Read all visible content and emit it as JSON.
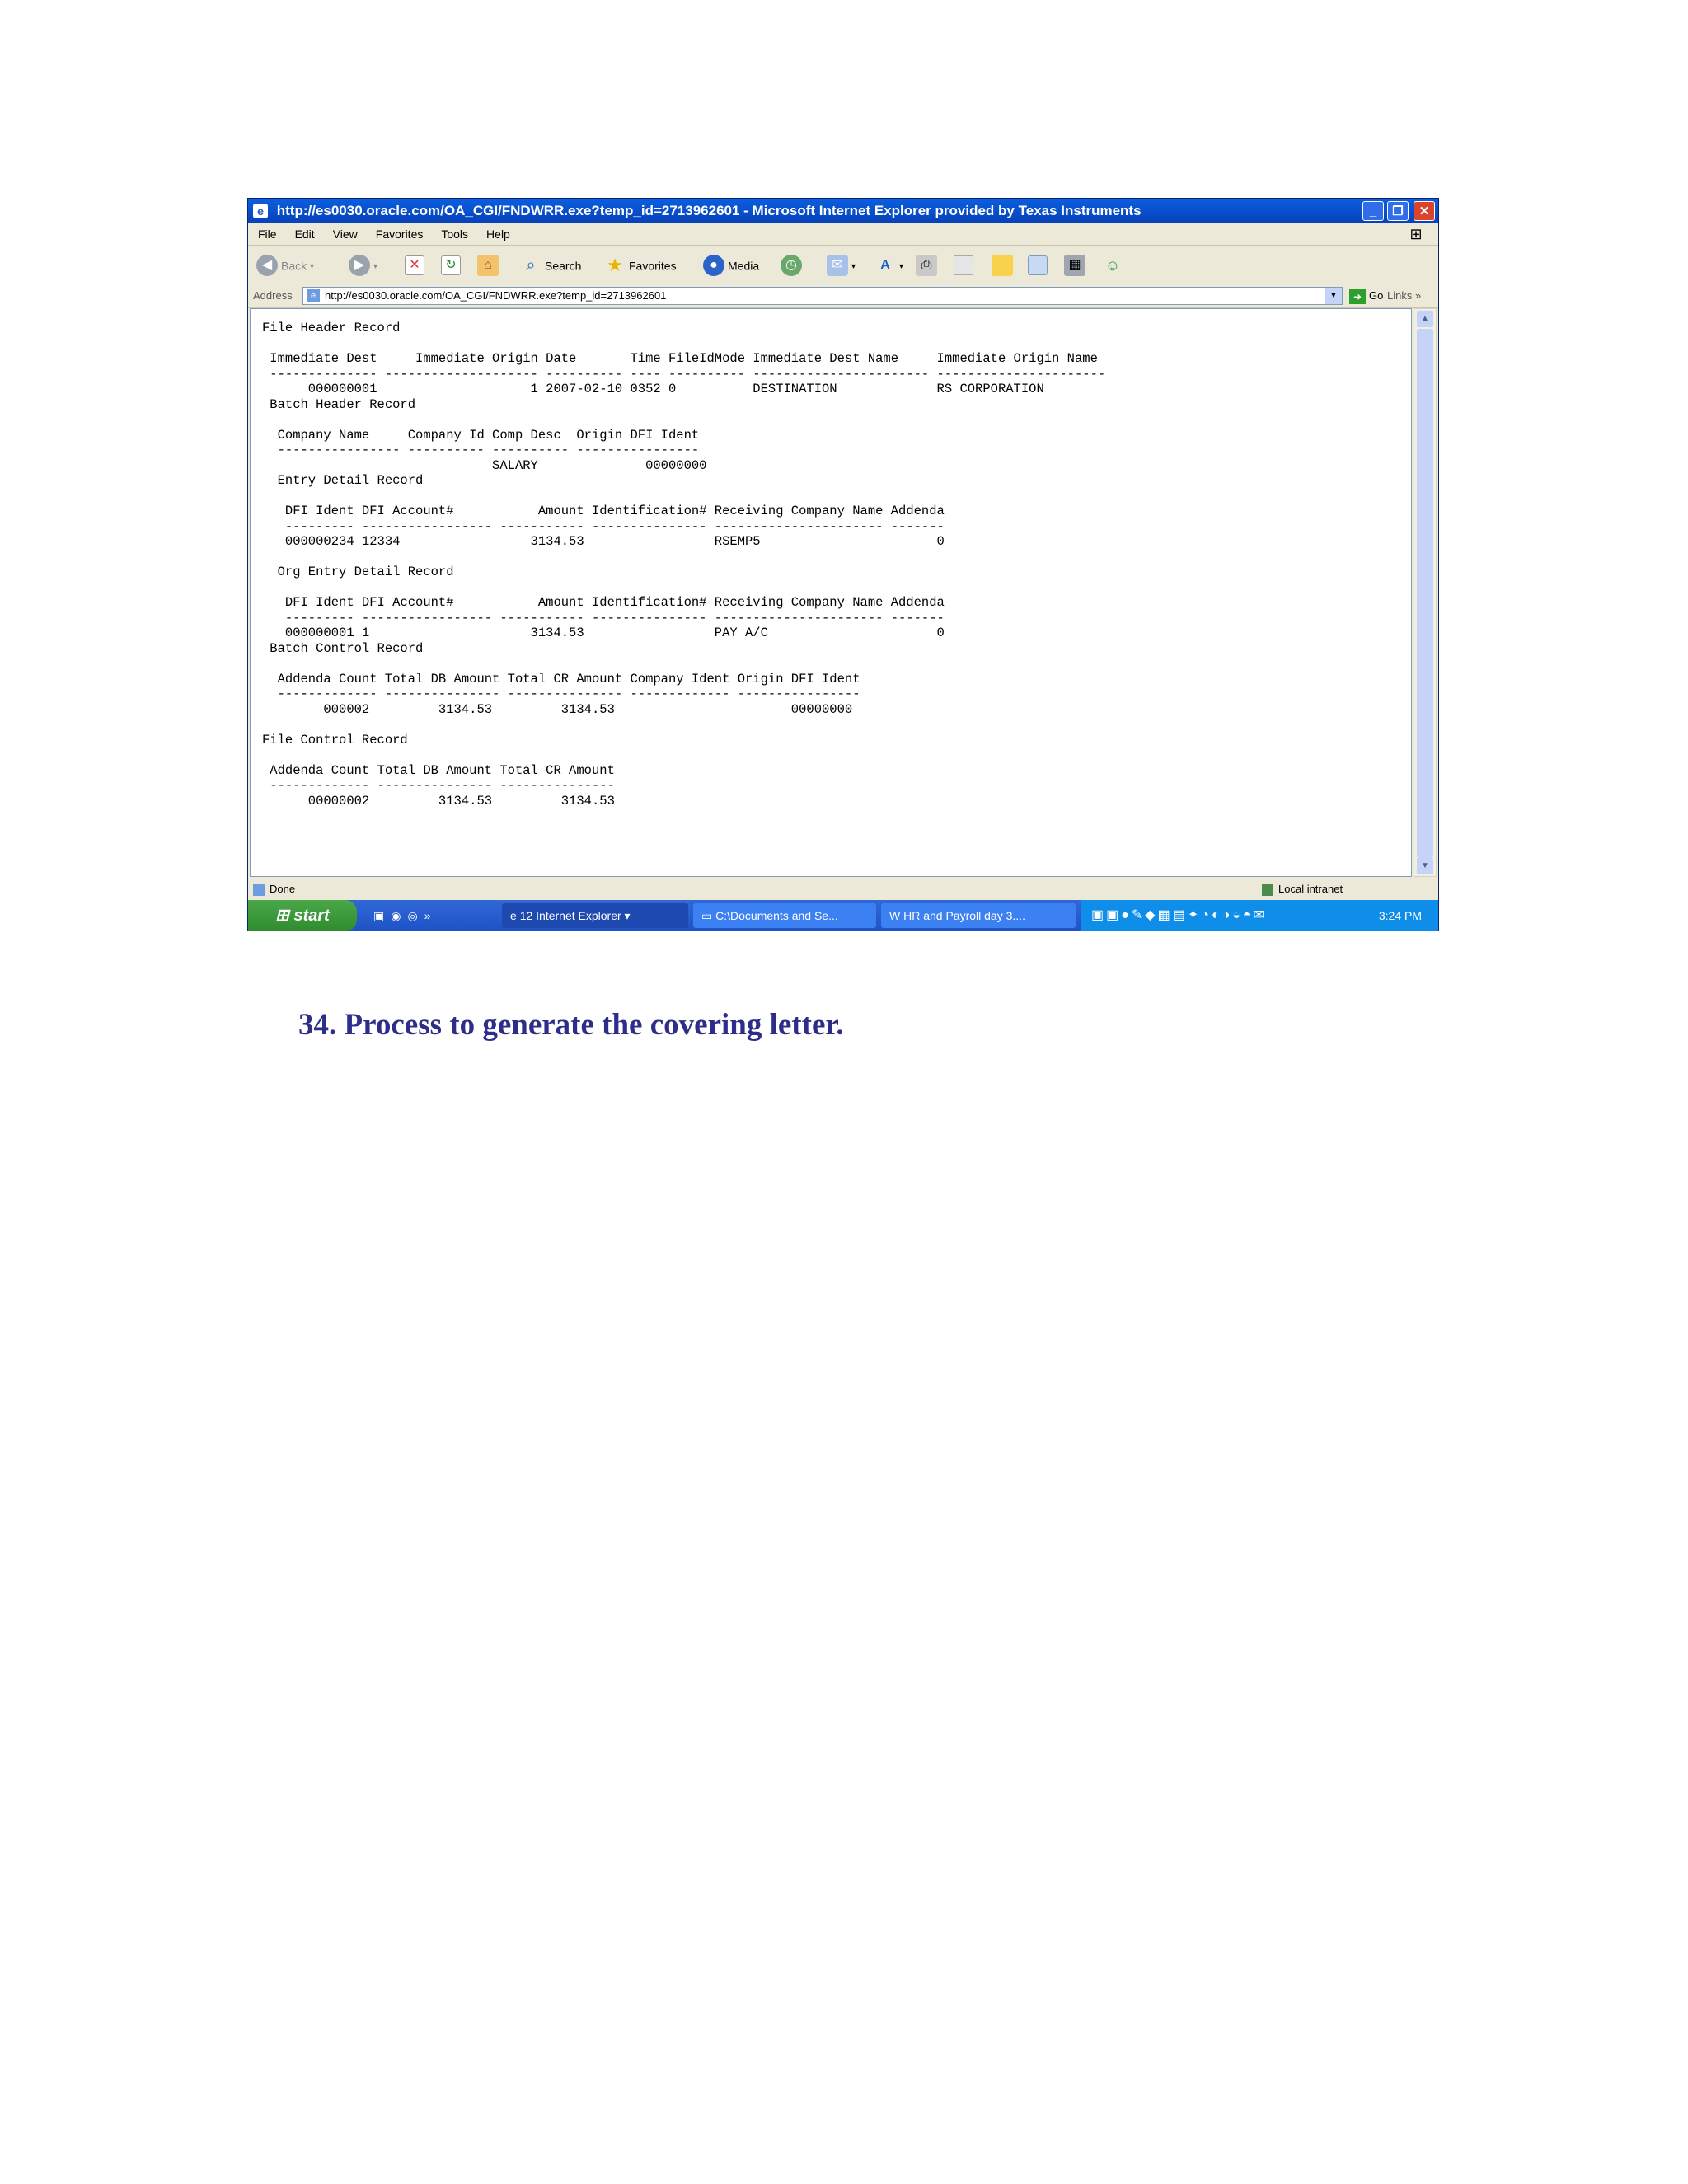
{
  "window": {
    "title": "http://es0030.oracle.com/OA_CGI/FNDWRR.exe?temp_id=2713962601 - Microsoft Internet Explorer provided by Texas Instruments"
  },
  "menu": [
    "File",
    "Edit",
    "View",
    "Favorites",
    "Tools",
    "Help"
  ],
  "toolbar": {
    "back": "Back",
    "search": "Search",
    "favorites": "Favorites",
    "media": "Media"
  },
  "address": {
    "label": "Address",
    "url": "http://es0030.oracle.com/OA_CGI/FNDWRR.exe?temp_id=2713962601",
    "go": "Go",
    "links": "Links"
  },
  "report": {
    "file_header_title": "File Header Record",
    "file_header_columns": " Immediate Dest     Immediate Origin Date       Time FileIdMode Immediate Dest Name     Immediate Origin Name",
    "file_header_rule": " -------------- -------------------- ---------- ---- ---------- ----------------------- ----------------------",
    "file_header_values": "      000000001                    1 2007-02-10 0352 0          DESTINATION             RS CORPORATION",
    "batch_header_title": " Batch Header Record",
    "batch_header_columns": "  Company Name     Company Id Comp Desc  Origin DFI Ident",
    "batch_header_rule": "  ---------------- ---------- ---------- ----------------",
    "batch_header_values": "                              SALARY              00000000",
    "entry_detail_title": "  Entry Detail Record",
    "entry_detail_columns": "   DFI Ident DFI Account#           Amount Identification# Receiving Company Name Addenda",
    "entry_detail_rule": "   --------- ----------------- ----------- --------------- ---------------------- -------",
    "entry_detail_values": "   000000234 12334                 3134.53                 RSEMP5                       0",
    "org_entry_title": "  Org Entry Detail Record",
    "org_entry_columns": "   DFI Ident DFI Account#           Amount Identification# Receiving Company Name Addenda",
    "org_entry_rule": "   --------- ----------------- ----------- --------------- ---------------------- -------",
    "org_entry_values": "   000000001 1                     3134.53                 PAY A/C                      0",
    "batch_control_title": " Batch Control Record",
    "batch_control_columns": "  Addenda Count Total DB Amount Total CR Amount Company Ident Origin DFI Ident",
    "batch_control_rule": "  ------------- --------------- --------------- ------------- ----------------",
    "batch_control_values": "        000002         3134.53         3134.53                       00000000",
    "file_control_title": "File Control Record",
    "file_control_columns": " Addenda Count Total DB Amount Total CR Amount",
    "file_control_rule": " ------------- --------------- ---------------",
    "file_control_values": "      00000002         3134.53         3134.53"
  },
  "status": {
    "left": "Done",
    "zone": "Local intranet"
  },
  "taskbar": {
    "start": "start",
    "tasks": [
      "12 Internet Explorer",
      "C:\\Documents and Se...",
      "HR and Payroll day 3...."
    ],
    "clock": "3:24 PM"
  },
  "caption": "34. Process to generate the covering letter."
}
